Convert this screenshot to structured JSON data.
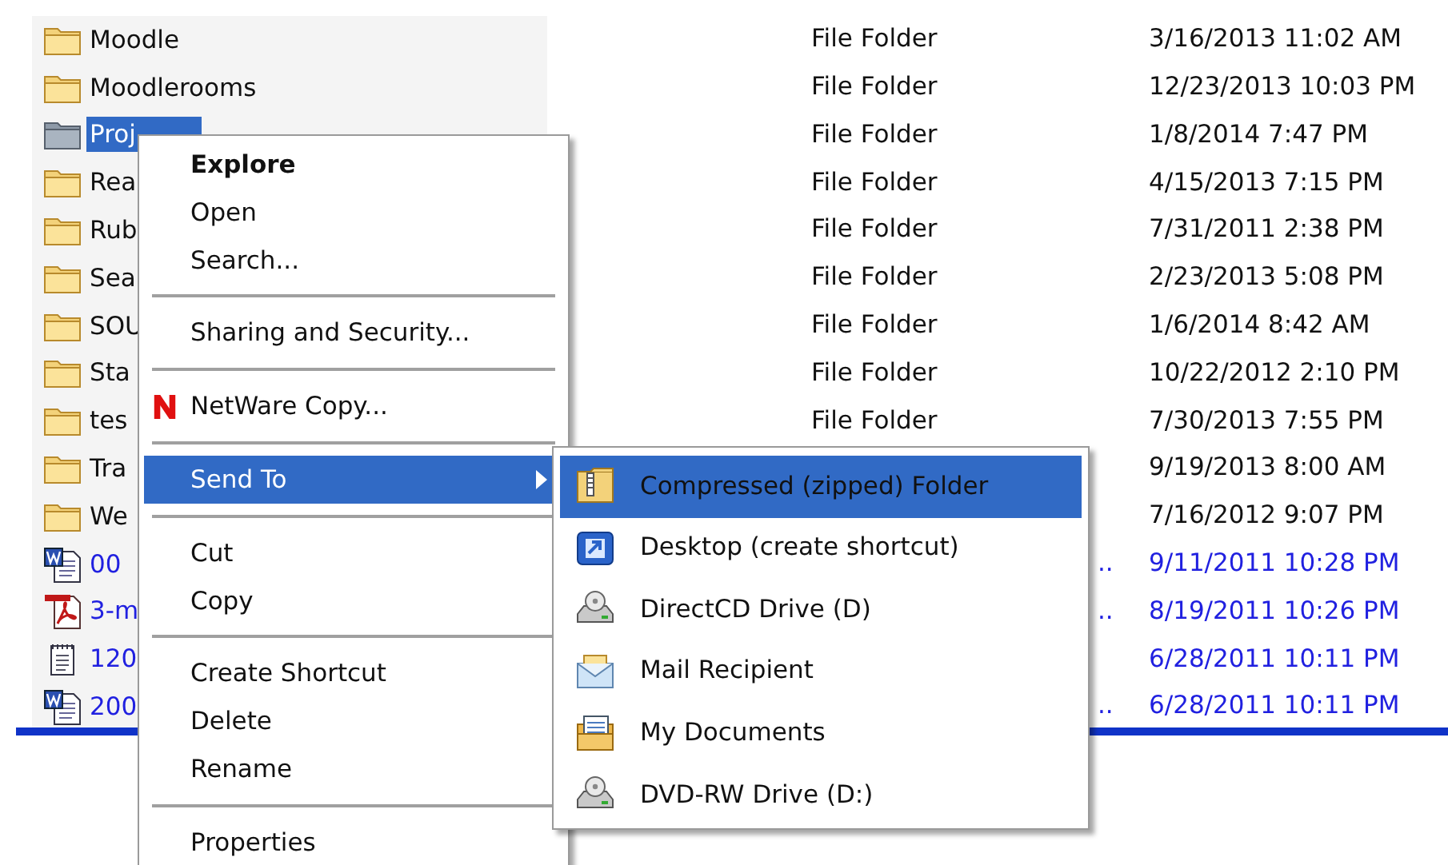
{
  "files": [
    {
      "kind": "folder",
      "name": "Moodle",
      "type": "File Folder",
      "modified": "3/16/2013 11:02 AM",
      "selected": false
    },
    {
      "kind": "folder",
      "name": "Moodlerooms",
      "type": "File Folder",
      "modified": "12/23/2013 10:03 PM",
      "selected": false
    },
    {
      "kind": "folder",
      "name": "Proj",
      "type": "File Folder",
      "modified": "1/8/2014 7:47 PM",
      "selected": true
    },
    {
      "kind": "folder",
      "name": "Rea",
      "type": "File Folder",
      "modified": "4/15/2013 7:15 PM",
      "selected": false
    },
    {
      "kind": "folder",
      "name": "Rub",
      "type": "File Folder",
      "modified": "7/31/2011 2:38 PM",
      "selected": false
    },
    {
      "kind": "folder",
      "name": "Sea",
      "type": "File Folder",
      "modified": "2/23/2013 5:08 PM",
      "selected": false
    },
    {
      "kind": "folder",
      "name": "SOU",
      "type": "File Folder",
      "modified": "1/6/2014 8:42 AM",
      "selected": false
    },
    {
      "kind": "folder",
      "name": "Sta",
      "type": "File Folder",
      "modified": "10/22/2012 2:10 PM",
      "selected": false
    },
    {
      "kind": "folder",
      "name": "tes",
      "type": "File Folder",
      "modified": "7/30/2013 7:55 PM",
      "selected": false
    },
    {
      "kind": "folder",
      "name": "Tra",
      "modified": "9/19/2013 8:00 AM",
      "selected": false
    },
    {
      "kind": "folder",
      "name": "We",
      "modified": "7/16/2012 9:07 PM",
      "selected": false
    },
    {
      "kind": "word",
      "name": "00",
      "type": "..",
      "modified": "9/11/2011 10:28 PM",
      "selected": false
    },
    {
      "kind": "pdf",
      "name": "3-m",
      "type": "..",
      "modified": "8/19/2011 10:26 PM",
      "selected": false
    },
    {
      "kind": "text",
      "name": "120",
      "modified": "6/28/2011 10:11 PM",
      "selected": false
    },
    {
      "kind": "word",
      "name": "200",
      "type": "..",
      "modified": "6/28/2011 10:11 PM",
      "selected": false
    }
  ],
  "context_menu": {
    "items": [
      {
        "kind": "item",
        "label": "Explore",
        "default": true,
        "selected": false
      },
      {
        "kind": "item",
        "label": "Open",
        "default": false,
        "selected": false
      },
      {
        "kind": "item",
        "label": "Search...",
        "default": false,
        "selected": false
      },
      {
        "kind": "separator"
      },
      {
        "kind": "item",
        "label": "Sharing and Security...",
        "default": false,
        "selected": false
      },
      {
        "kind": "separator"
      },
      {
        "kind": "netware",
        "label": "NetWare Copy...",
        "default": false,
        "selected": false
      },
      {
        "kind": "separator"
      },
      {
        "kind": "submenu",
        "label": "Send To",
        "default": false,
        "selected": true
      },
      {
        "kind": "separator"
      },
      {
        "kind": "item",
        "label": "Cut",
        "default": false,
        "selected": false
      },
      {
        "kind": "item",
        "label": "Copy",
        "default": false,
        "selected": false
      },
      {
        "kind": "separator"
      },
      {
        "kind": "item",
        "label": "Create Shortcut",
        "default": false,
        "selected": false
      },
      {
        "kind": "item",
        "label": "Delete",
        "default": false,
        "selected": false
      },
      {
        "kind": "item",
        "label": "Rename",
        "default": false,
        "selected": false
      },
      {
        "kind": "separator"
      },
      {
        "kind": "item",
        "label": "Properties",
        "default": false,
        "selected": false
      }
    ]
  },
  "send_to_menu": {
    "items": [
      {
        "kind": "zip",
        "label": "Compressed (zipped) Folder",
        "selected": true
      },
      {
        "kind": "desktop",
        "label": "Desktop (create shortcut)",
        "selected": false
      },
      {
        "kind": "drive",
        "label": "DirectCD Drive (D)",
        "selected": false
      },
      {
        "kind": "mail",
        "label": "Mail Recipient",
        "selected": false
      },
      {
        "kind": "documents",
        "label": "My Documents",
        "selected": false
      },
      {
        "kind": "drive",
        "label": "DVD-RW Drive (D:)",
        "selected": false
      }
    ]
  }
}
